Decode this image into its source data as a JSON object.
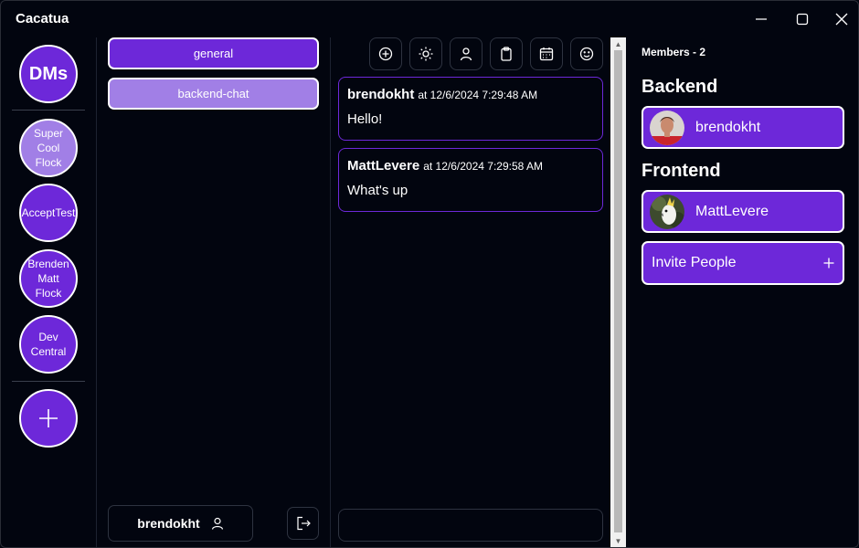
{
  "window": {
    "title": "Cacatua"
  },
  "servers": {
    "dms_label": "DMs",
    "items": [
      {
        "line1": "Super",
        "line2": "Cool",
        "line3": "Flock"
      },
      {
        "line1": "AcceptTest",
        "line2": "",
        "line3": ""
      },
      {
        "line1": "Brenden",
        "line2": "Matt",
        "line3": "Flock"
      },
      {
        "line1": "Dev",
        "line2": "Central",
        "line3": ""
      }
    ],
    "add_label": "+"
  },
  "channels": {
    "items": [
      {
        "label": "general"
      },
      {
        "label": "backend-chat"
      }
    ],
    "current_user": "brendokht"
  },
  "messages": [
    {
      "author": "brendokht",
      "time": "at 12/6/2024 7:29:48 AM",
      "text": "Hello!"
    },
    {
      "author": "MattLevere",
      "time": "at 12/6/2024 7:29:58 AM",
      "text": "What's up"
    }
  ],
  "members": {
    "header": "Members - 2",
    "roles": [
      {
        "title": "Backend",
        "member": "brendokht"
      },
      {
        "title": "Frontend",
        "member": "MattLevere"
      }
    ],
    "invite_label": "Invite People",
    "invite_icon": "+"
  },
  "icons": {
    "toolbar": [
      "add-circle-icon",
      "sun-icon",
      "person-icon",
      "clipboard-icon",
      "calendar-icon",
      "smiley-icon"
    ]
  },
  "colors": {
    "accent": "#6d28d9",
    "accent_light": "#a17fe6",
    "background": "#02050f"
  }
}
